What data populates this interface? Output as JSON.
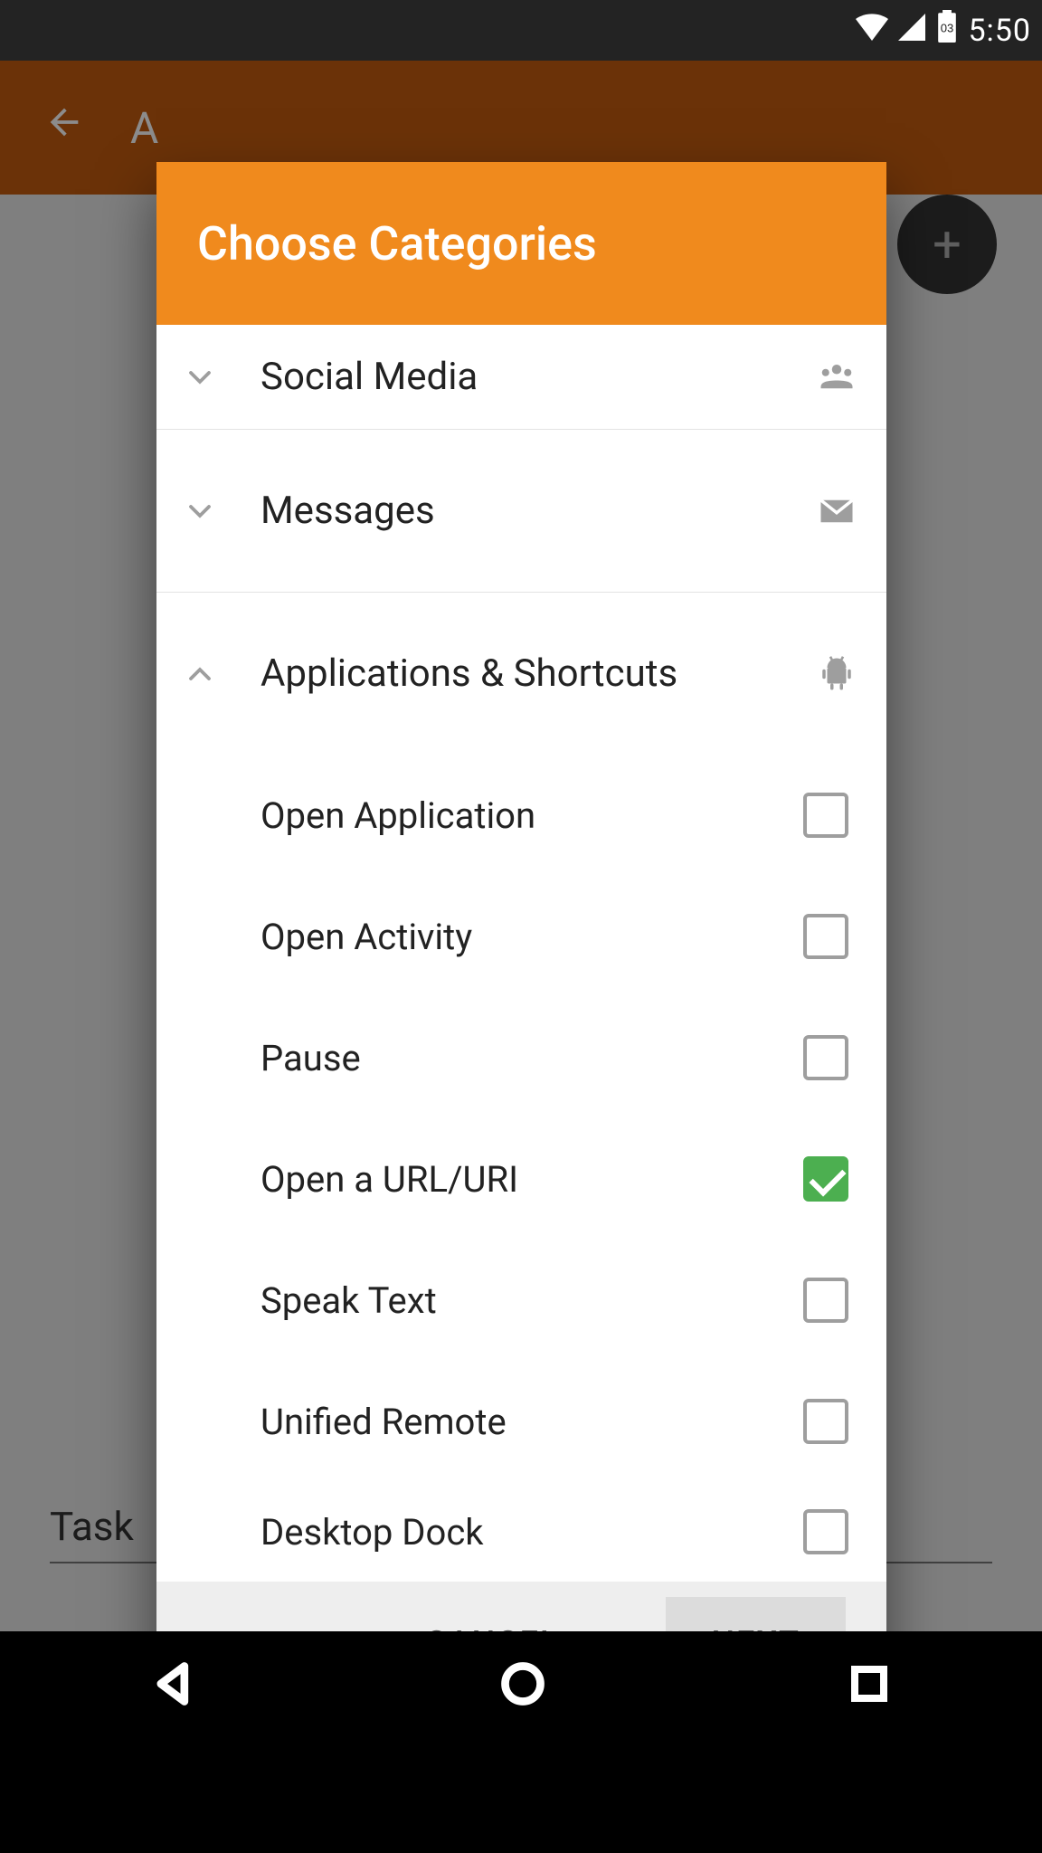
{
  "statusbar": {
    "time": "5:50",
    "battery_label": "03"
  },
  "appbar": {
    "title_initial": "A",
    "task_label": "Task"
  },
  "dialog": {
    "title": "Choose Categories",
    "actions": {
      "cancel": "CANCEL",
      "next": "NEXT"
    },
    "categories": [
      {
        "label": "Social Media",
        "expanded": false,
        "icon": "social"
      },
      {
        "label": "Messages",
        "expanded": false,
        "icon": "mail"
      },
      {
        "label": "Applications & Shortcuts",
        "expanded": true,
        "icon": "android"
      }
    ],
    "sub_items": [
      {
        "label": "Open Application",
        "checked": false
      },
      {
        "label": "Open Activity",
        "checked": false
      },
      {
        "label": "Pause",
        "checked": false
      },
      {
        "label": "Open a URL/URI",
        "checked": true
      },
      {
        "label": "Speak Text",
        "checked": false
      },
      {
        "label": "Unified Remote",
        "checked": false
      },
      {
        "label": "Desktop Dock",
        "checked": false
      }
    ]
  }
}
